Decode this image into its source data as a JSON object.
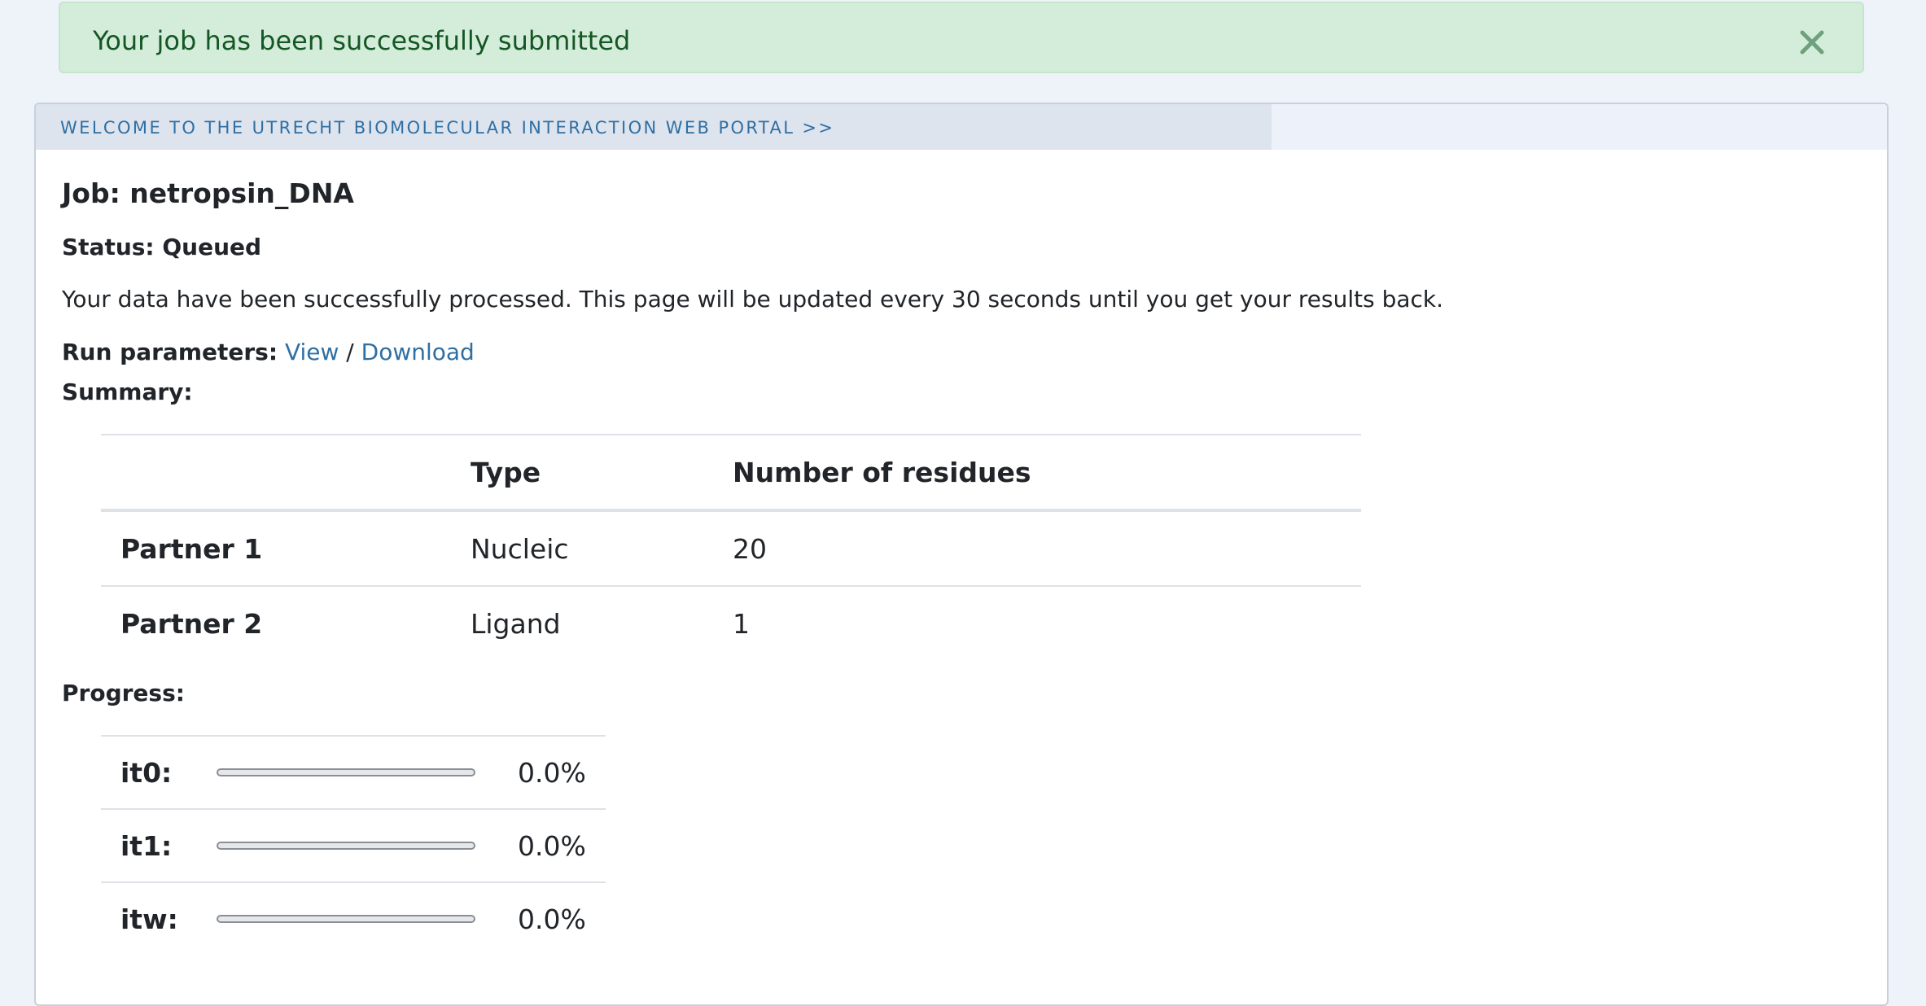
{
  "alert": {
    "message": "Your job has been successfully submitted",
    "close_icon": "close-x-icon",
    "color": "#155724",
    "background": "#d4edda"
  },
  "header": {
    "welcome_link": "WELCOME TO THE UTRECHT BIOMOLECULAR INTERACTION WEB PORTAL >>"
  },
  "job": {
    "title": "Job: netropsin_DNA",
    "status": "Status: Queued",
    "description": "Your data have been successfully processed. This page will be updated every 30 seconds until you get your results back.",
    "run_params_label": "Run parameters:",
    "view_link": "View",
    "separator": "/",
    "download_link": "Download",
    "link_color": "#2f6fa3"
  },
  "summary": {
    "label": "Summary:",
    "columns": [
      "",
      "Type",
      "Number of residues"
    ],
    "rows": [
      {
        "partner": "Partner 1",
        "type": "Nucleic",
        "residues": "20"
      },
      {
        "partner": "Partner 2",
        "type": "Ligand",
        "residues": "1"
      }
    ]
  },
  "progress": {
    "label": "Progress:",
    "items": [
      {
        "name": "it0:",
        "value": 0.0,
        "text": "0.0%"
      },
      {
        "name": "it1:",
        "value": 0.0,
        "text": "0.0%"
      },
      {
        "name": "itw:",
        "value": 0.0,
        "text": "0.0%"
      }
    ]
  }
}
